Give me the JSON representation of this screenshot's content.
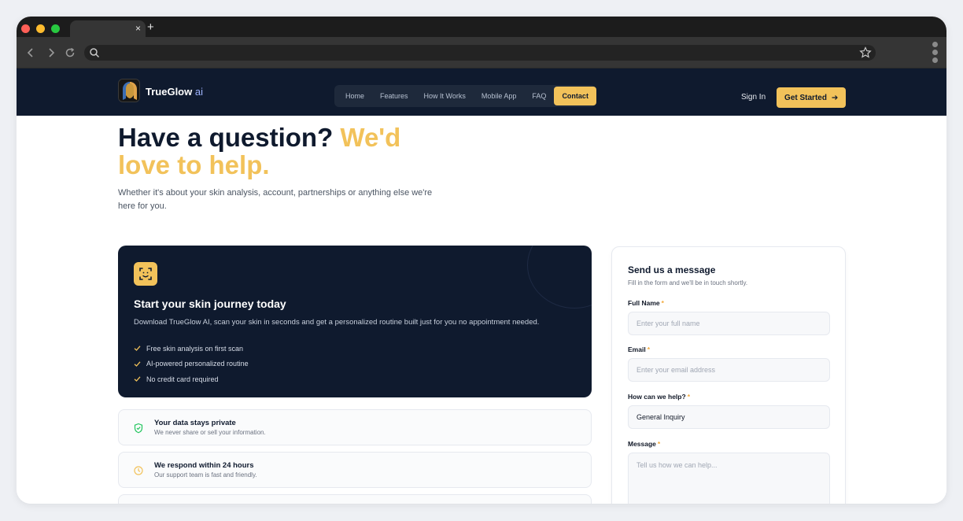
{
  "browser": {
    "tab_close": "×",
    "new_tab": "+"
  },
  "site": {
    "brand_name": "TrueGlow",
    "brand_suffix": " ai",
    "nav": [
      "Home",
      "Features",
      "How It Works",
      "Mobile App",
      "FAQ",
      "Contact"
    ],
    "active_nav": "Contact",
    "sign_in": "Sign In",
    "get_started": "Get Started",
    "colors": {
      "navy": "#0f1a2e",
      "gold": "#f2c25a"
    }
  },
  "hero": {
    "title_dark": "Have a question?",
    "title_accent": "We'd love to help.",
    "subtitle": "Whether it's about your skin analysis, account, partnerships or anything else we're here for you."
  },
  "promo": {
    "icon": "face-scan-icon",
    "title": "Start your skin journey today",
    "description": "Download TrueGlow AI, scan your skin in seconds and get a personalized routine built just for you no appointment needed.",
    "features": [
      "Free skin analysis on first scan",
      "AI-powered personalized routine",
      "No credit card required"
    ]
  },
  "info_boxes": [
    {
      "icon": "shield-icon",
      "title": "Your data stays private",
      "subtitle": "We never share or sell your information."
    },
    {
      "icon": "clock-icon",
      "title": "We respond within 24 hours",
      "subtitle": "Our support team is fast and friendly."
    },
    {
      "icon": "",
      "title": "",
      "subtitle": ""
    }
  ],
  "form": {
    "title": "Send us a message",
    "subtitle": "Fill in the form and we'll be in touch shortly.",
    "required_mark": "*",
    "fields": {
      "full_name": {
        "label": "Full Name",
        "placeholder": "Enter your full name"
      },
      "email": {
        "label": "Email",
        "placeholder": "Enter your email address"
      },
      "topic": {
        "label": "How can we help?",
        "value": "General Inquiry"
      },
      "message": {
        "label": "Message",
        "placeholder": "Tell us how we can help..."
      }
    }
  }
}
